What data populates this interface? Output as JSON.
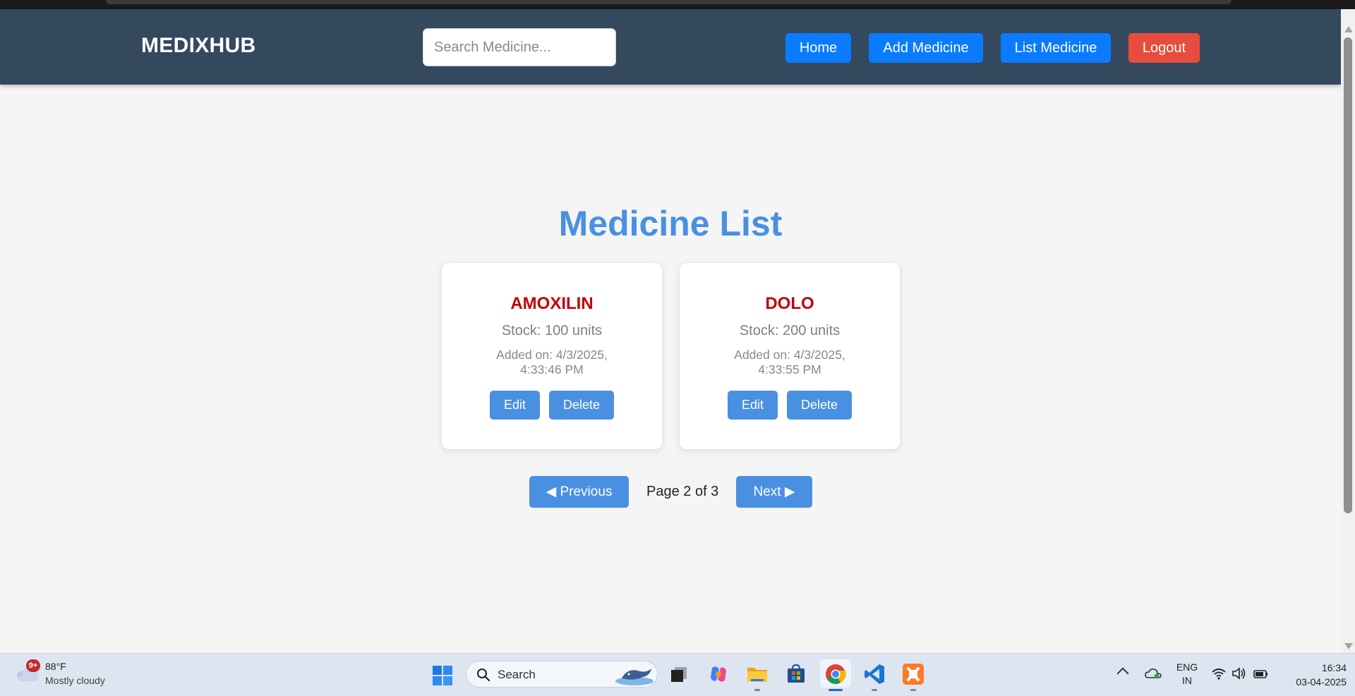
{
  "navbar": {
    "brand": "MEDIXHUB",
    "search_placeholder": "Search Medicine...",
    "links": {
      "home": "Home",
      "add": "Add Medicine",
      "list": "List Medicine",
      "logout": "Logout"
    },
    "colors": {
      "bar": "#34495e",
      "button": "#0a7bff",
      "logout": "#e74c3c"
    }
  },
  "main": {
    "title": "Medicine List",
    "medicines": [
      {
        "name": "AMOXILIN",
        "stock": "Stock: 100 units",
        "added_line1": "Added on: 4/3/2025,",
        "added_line2": "4:33:46 PM",
        "edit": "Edit",
        "delete": "Delete"
      },
      {
        "name": "DOLO",
        "stock": "Stock: 200 units",
        "added_line1": "Added on: 4/3/2025,",
        "added_line2": "4:33:55 PM",
        "edit": "Edit",
        "delete": "Delete"
      }
    ],
    "pagination": {
      "previous": "◀ Previous",
      "info": "Page 2 of 3",
      "next": "Next ▶"
    },
    "colors": {
      "title": "#4a90e2",
      "medicine_name": "#c0000a",
      "button": "#4a90e2"
    }
  },
  "taskbar": {
    "weather": {
      "badge": "9+",
      "temp": "88°F",
      "desc": "Mostly cloudy",
      "icon": "cloud-icon"
    },
    "search_label": "Search",
    "apps": [
      "task-view-icon",
      "copilot-icon",
      "file-explorer-icon",
      "microsoft-store-icon",
      "chrome-icon",
      "vscode-icon",
      "xampp-icon"
    ],
    "tray": {
      "lang_line1": "ENG",
      "lang_line2": "IN",
      "time": "16:34",
      "date": "03-04-2025"
    }
  }
}
